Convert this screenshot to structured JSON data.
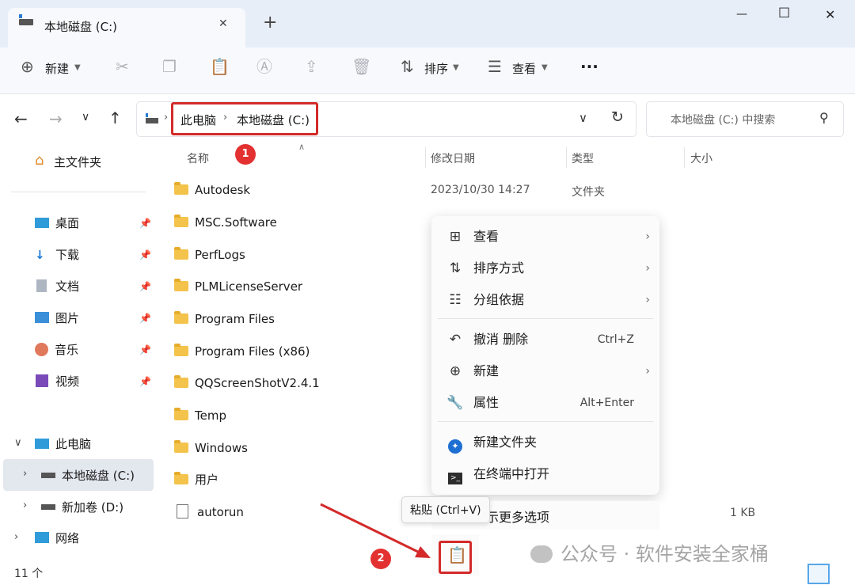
{
  "window": {
    "tab_title": "本地磁盘 (C:)",
    "tab_close": "✕",
    "new_tab": "+",
    "minimize": "—",
    "maximize": "☐",
    "close": "✕"
  },
  "toolbar": {
    "new_label": "新建",
    "sort_label": "排序",
    "view_label": "查看",
    "more_label": "···"
  },
  "nav": {
    "breadcrumb": [
      "此电脑",
      "本地磁盘 (C:)"
    ],
    "search_placeholder": "本地磁盘 (C:) 中搜索"
  },
  "sidebar": {
    "home": "主文件夹",
    "quick": [
      {
        "label": "桌面"
      },
      {
        "label": "下载"
      },
      {
        "label": "文档"
      },
      {
        "label": "图片"
      },
      {
        "label": "音乐"
      },
      {
        "label": "视频"
      }
    ],
    "this_pc": "此电脑",
    "drive_c": "本地磁盘 (C:)",
    "drive_d": "新加卷 (D:)",
    "network": "网络"
  },
  "columns": {
    "name": "名称",
    "modified": "修改日期",
    "type": "类型",
    "size": "大小"
  },
  "files": [
    {
      "name": "Autodesk",
      "modified": "2023/10/30 14:27",
      "type": "文件夹",
      "size": ""
    },
    {
      "name": "MSC.Software",
      "modified": "",
      "type": "",
      "size": ""
    },
    {
      "name": "PerfLogs",
      "modified": "",
      "type": "",
      "size": ""
    },
    {
      "name": "PLMLicenseServer",
      "modified": "",
      "type": "",
      "size": ""
    },
    {
      "name": "Program Files",
      "modified": "",
      "type": "",
      "size": ""
    },
    {
      "name": "Program Files (x86)",
      "modified": "",
      "type": "",
      "size": ""
    },
    {
      "name": "QQScreenShotV2.4.1",
      "modified": "",
      "type": "",
      "size": ""
    },
    {
      "name": "Temp",
      "modified": "",
      "type": "",
      "size": ""
    },
    {
      "name": "Windows",
      "modified": "",
      "type": "",
      "size": ""
    },
    {
      "name": "用户",
      "modified": "",
      "type": "",
      "size": ""
    },
    {
      "name": "autorun",
      "modified": "",
      "type": "",
      "size": "1 KB"
    }
  ],
  "context_menu": {
    "view": "查看",
    "sort": "排序方式",
    "group": "分组依据",
    "undo": "撤消 删除",
    "undo_shortcut": "Ctrl+Z",
    "new": "新建",
    "properties": "属性",
    "properties_shortcut": "Alt+Enter",
    "new_folder": "新建文件夹",
    "terminal": "在终端中打开",
    "more_options": "显示更多选项"
  },
  "tooltip": "粘贴 (Ctrl+V)",
  "status": {
    "count": "11 个"
  },
  "watermark": "公众号 · 软件安装全家桶",
  "annotations": {
    "step1": "1",
    "step2": "2"
  },
  "colors": {
    "accent": "#0067c0",
    "annotation_red": "#d42a2a",
    "folder": "#f3c34b"
  }
}
